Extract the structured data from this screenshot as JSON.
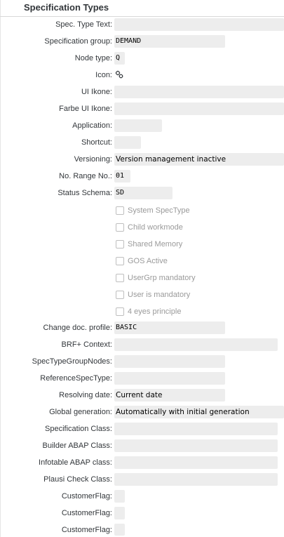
{
  "title": "Specification Types",
  "fields": [
    {
      "label": "Spec. Type Text:",
      "value": ""
    },
    {
      "label": "Specification group:",
      "value": "DEMAND"
    },
    {
      "label": "Node type:",
      "value": "Q"
    },
    {
      "label": "Icon:",
      "icon": "gear-cluster-icon"
    },
    {
      "label": "UI Ikone:",
      "value": ""
    },
    {
      "label": "Farbe UI Ikone:",
      "value": ""
    },
    {
      "label": "Application:",
      "value": ""
    },
    {
      "label": "Shortcut:",
      "value": ""
    },
    {
      "label": "Versioning:",
      "value": "Version management inactive"
    },
    {
      "label": "No. Range No.:",
      "value": "01"
    },
    {
      "label": "Status Schema:",
      "value": "SD"
    }
  ],
  "checkboxes": [
    {
      "label": "System SpecType",
      "checked": false
    },
    {
      "label": "Child workmode",
      "checked": false
    },
    {
      "label": "Shared Memory",
      "checked": false
    },
    {
      "label": "GOS Active",
      "checked": false
    },
    {
      "label": "UserGrp mandatory",
      "checked": false
    },
    {
      "label": "User is mandatory",
      "checked": false
    },
    {
      "label": "4 eyes principle",
      "checked": false
    }
  ],
  "fields2": [
    {
      "label": "Change doc. profile:",
      "value": "BASIC"
    },
    {
      "label": "BRF+ Context:",
      "value": ""
    },
    {
      "label": "SpecTypeGroupNodes:",
      "value": ""
    },
    {
      "label": "ReferenceSpecType:",
      "value": ""
    },
    {
      "label": "Resolving date:",
      "value": "Current date"
    },
    {
      "label": "Global generation:",
      "value": "Automatically with initial generation"
    },
    {
      "label": "Specification Class:",
      "value": ""
    },
    {
      "label": "Builder ABAP Class:",
      "value": ""
    },
    {
      "label": "Infotable ABAP class:",
      "value": ""
    },
    {
      "label": "Plausi Check Class:",
      "value": ""
    },
    {
      "label": "CustomerFlag:",
      "value": ""
    },
    {
      "label": "CustomerFlag:",
      "value": ""
    },
    {
      "label": "CustomerFlag:",
      "value": ""
    }
  ]
}
